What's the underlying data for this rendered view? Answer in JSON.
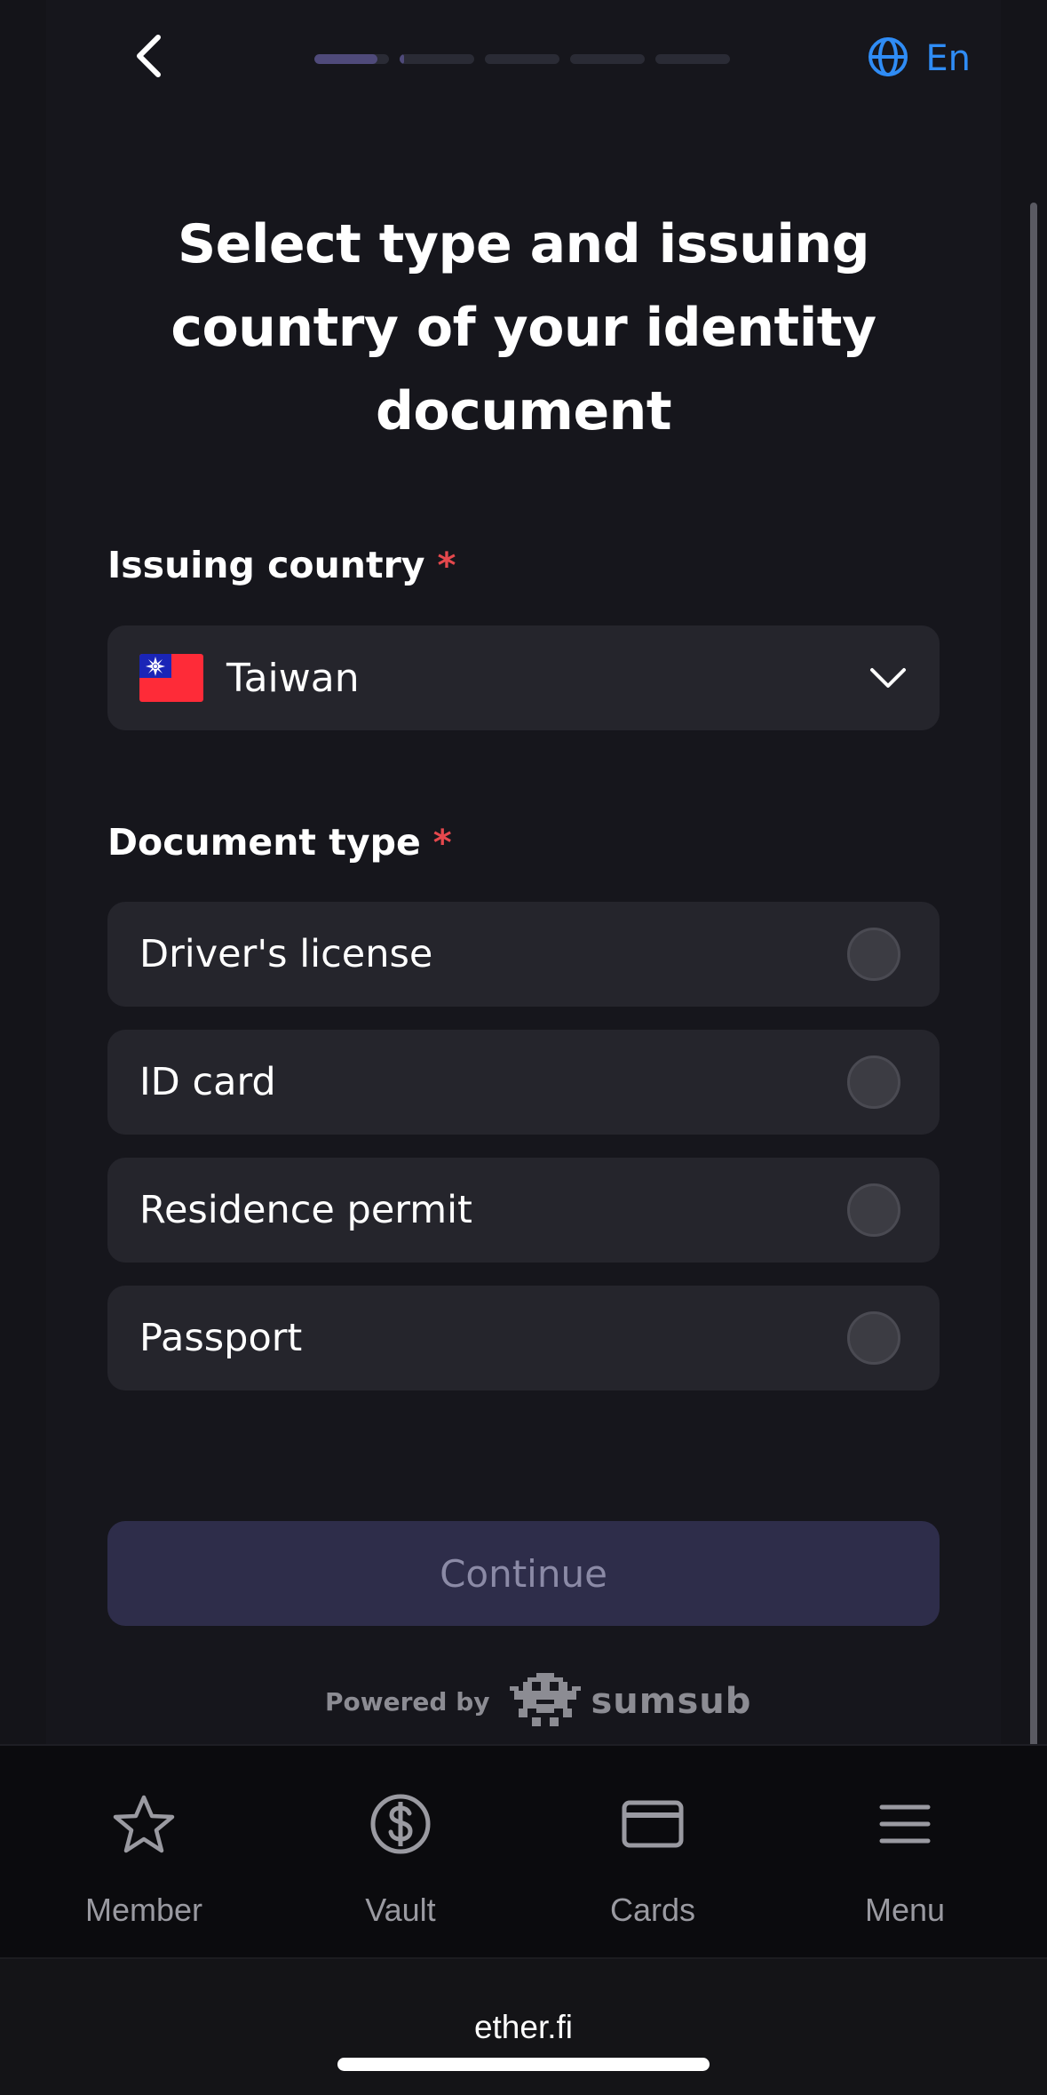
{
  "header": {
    "language_label": "En",
    "progress_segments": [
      0.85,
      0.06,
      0,
      0,
      0
    ]
  },
  "title": "Select type and issuing country of your identity document",
  "country": {
    "label": "Issuing country",
    "required_mark": "*",
    "selected": "Taiwan"
  },
  "document_type": {
    "label": "Document type",
    "required_mark": "*",
    "options": [
      {
        "label": "Driver's license",
        "selected": false
      },
      {
        "label": "ID card",
        "selected": false
      },
      {
        "label": "Residence permit",
        "selected": false
      },
      {
        "label": "Passport",
        "selected": false
      }
    ]
  },
  "continue_label": "Continue",
  "powered_by": {
    "text": "Powered by",
    "brand": "sumsub"
  },
  "bottom_nav": {
    "items": [
      {
        "label": "Member",
        "icon": "star-icon"
      },
      {
        "label": "Vault",
        "icon": "dollar-circle-icon"
      },
      {
        "label": "Cards",
        "icon": "card-icon"
      },
      {
        "label": "Menu",
        "icon": "menu-icon"
      }
    ]
  },
  "browser": {
    "domain": "ether.fi"
  },
  "colors": {
    "accent_link": "#2f8cf5",
    "required": "#e5484d",
    "button_disabled_bg": "#2e2d4a",
    "progress_active": "#4f4a7a"
  }
}
